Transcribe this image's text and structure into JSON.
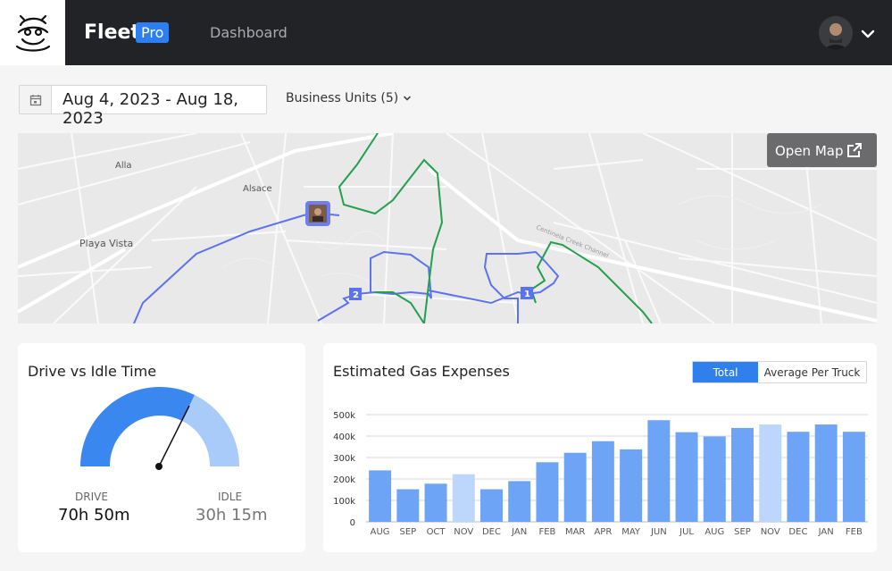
{
  "header": {
    "brand": "Fleet",
    "badge": "Pro",
    "nav_item": "Dashboard"
  },
  "filters": {
    "date_range": "Aug 4, 2023 - Aug 18, 2023",
    "business_units": "Business Units (5)"
  },
  "map": {
    "open_map_label": "Open Map",
    "place_labels": [
      "Alla",
      "Alsace",
      "Playa Vista",
      "Centinela Creek Channel"
    ],
    "markers": [
      "1",
      "2"
    ]
  },
  "drive_idle": {
    "title": "Drive vs Idle Time",
    "drive_label": "DRIVE",
    "drive_value": "70h 50m",
    "idle_label": "IDLE",
    "idle_value": "30h 15m"
  },
  "gas": {
    "title": "Estimated Gas Expenses",
    "toggle_total": "Total",
    "toggle_avg": "Average Per Truck"
  },
  "colors": {
    "accent": "#2f80ed",
    "bar": "#6ea4f6",
    "bar_light": "#bcd7fb",
    "route_blue": "#5b73f0",
    "route_green": "#22a04b"
  },
  "chart_data": {
    "type": "bar",
    "title": "Estimated Gas Expenses",
    "categories": [
      "AUG",
      "SEP",
      "OCT",
      "NOV",
      "DEC",
      "JAN",
      "FEB",
      "MAR",
      "APR",
      "MAY",
      "JUN",
      "JUL",
      "AUG",
      "SEP",
      "NOV",
      "DEC",
      "JAN",
      "FEB"
    ],
    "values": [
      240000,
      152000,
      178000,
      222000,
      152000,
      190000,
      278000,
      322000,
      376000,
      338000,
      474000,
      418000,
      398000,
      438000,
      454000,
      420000,
      454000,
      420000
    ],
    "highlighted": [
      false,
      false,
      false,
      true,
      false,
      false,
      false,
      false,
      false,
      false,
      false,
      false,
      false,
      false,
      true,
      false,
      false,
      false
    ],
    "yticks": [
      "0",
      "100k",
      "200k",
      "300k",
      "400k",
      "500k"
    ],
    "ylim": [
      0,
      500000
    ],
    "grid": true,
    "xlabel": "",
    "ylabel": ""
  }
}
